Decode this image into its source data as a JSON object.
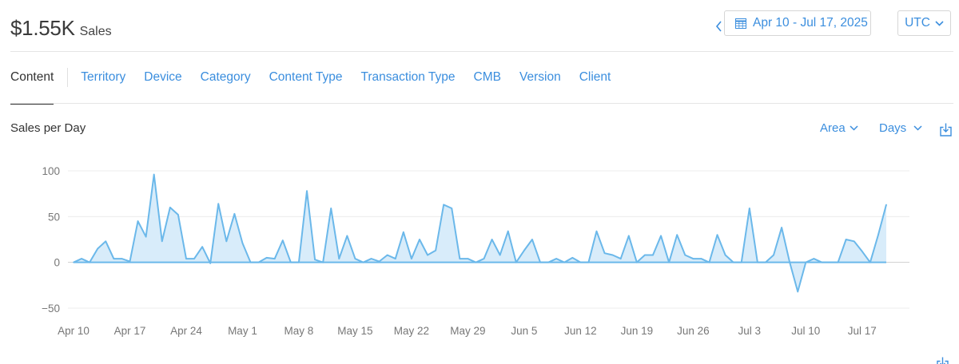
{
  "header": {
    "total_value": "$1.55K",
    "total_label": "Sales",
    "date_range": "Apr 10 - Jul 17, 2025",
    "timezone": "UTC"
  },
  "tabs": [
    "Content",
    "Territory",
    "Device",
    "Category",
    "Content Type",
    "Transaction Type",
    "CMB",
    "Version",
    "Client"
  ],
  "section": {
    "title": "Sales per Day",
    "chart_type_label": "Area",
    "interval_label": "Days"
  },
  "colors": {
    "accent": "#3b8ede",
    "series_line": "#6bb8ea",
    "series_fill": "#d8ecfa"
  },
  "chart_data": {
    "type": "area",
    "title": "Sales per Day",
    "x_start": "Apr 10",
    "x_end": "Jul 17",
    "x_tick_labels": [
      "Apr 10",
      "Apr 17",
      "Apr 24",
      "May 1",
      "May 8",
      "May 15",
      "May 22",
      "May 29",
      "Jun 5",
      "Jun 12",
      "Jun 19",
      "Jun 26",
      "Jul 3",
      "Jul 10",
      "Jul 17"
    ],
    "y_ticks": [
      100,
      50,
      0,
      -50
    ],
    "ylim": [
      -50,
      100
    ],
    "grid": true,
    "series": [
      {
        "values": [
          0,
          4,
          0,
          15,
          23,
          4,
          4,
          1,
          45,
          28,
          96,
          23,
          60,
          52,
          4,
          4,
          17,
          -1,
          64,
          23,
          53,
          21,
          0,
          0,
          5,
          4,
          24,
          0,
          0,
          78,
          3,
          0,
          59,
          4,
          29,
          4,
          0,
          4,
          1,
          8,
          4,
          33,
          4,
          25,
          8,
          13,
          63,
          59,
          4,
          4,
          0,
          4,
          25,
          8,
          34,
          0,
          13,
          25,
          0,
          0,
          4,
          0,
          5,
          0,
          0,
          34,
          10,
          8,
          4,
          29,
          0,
          8,
          8,
          29,
          0,
          30,
          8,
          4,
          4,
          0,
          30,
          8,
          0,
          0,
          59,
          0,
          0,
          8,
          38,
          0,
          -32,
          0,
          4,
          0,
          0,
          0,
          25,
          23,
          12,
          0,
          30,
          63
        ]
      }
    ]
  }
}
